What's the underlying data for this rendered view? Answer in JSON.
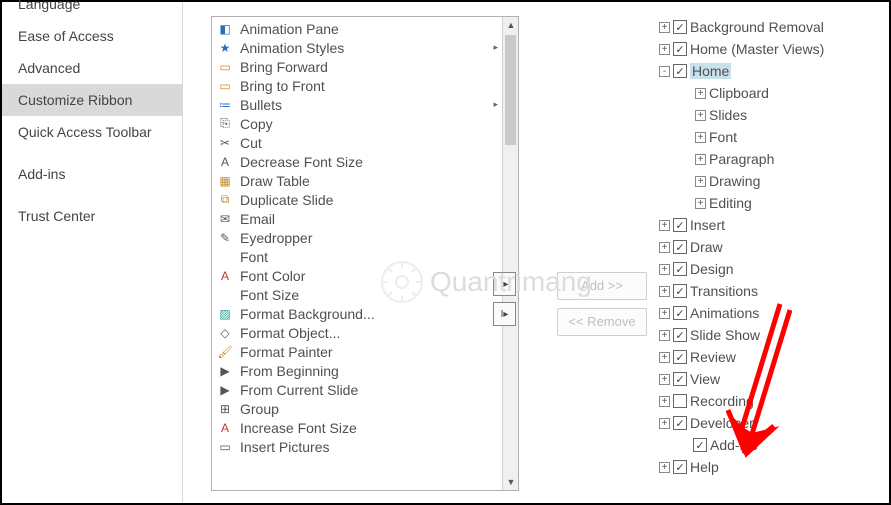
{
  "nav": {
    "items": [
      {
        "label": "Language",
        "selected": false
      },
      {
        "label": "Ease of Access",
        "selected": false
      },
      {
        "label": "Advanced",
        "selected": false
      },
      {
        "label": "Customize Ribbon",
        "selected": true
      },
      {
        "label": "Quick Access Toolbar",
        "selected": false
      },
      {
        "label": "Add-ins",
        "selected": false
      },
      {
        "label": "Trust Center",
        "selected": false
      }
    ]
  },
  "commands": [
    {
      "icon": "pane-icon",
      "glyph": "◧",
      "color": "#2a6fbf",
      "label": "Animation Pane"
    },
    {
      "icon": "star-icon",
      "glyph": "★",
      "color": "#2a6fbf",
      "label": "Animation Styles",
      "submenu": true
    },
    {
      "icon": "bring-forward-icon",
      "glyph": "▭",
      "color": "#d48b2a",
      "label": "Bring Forward"
    },
    {
      "icon": "bring-to-front-icon",
      "glyph": "▭",
      "color": "#d48b2a",
      "label": "Bring to Front"
    },
    {
      "icon": "bullets-icon",
      "glyph": "≔",
      "color": "#2a6fbf",
      "label": "Bullets",
      "submenu": true
    },
    {
      "icon": "copy-icon",
      "glyph": "⎘",
      "color": "#555",
      "label": "Copy"
    },
    {
      "icon": "cut-icon",
      "glyph": "✂",
      "color": "#555",
      "label": "Cut"
    },
    {
      "icon": "decrease-font-icon",
      "glyph": "A",
      "color": "#555",
      "label": "Decrease Font Size"
    },
    {
      "icon": "draw-table-icon",
      "glyph": "▦",
      "color": "#c58a2a",
      "label": "Draw Table"
    },
    {
      "icon": "duplicate-slide-icon",
      "glyph": "⧉",
      "color": "#c58a2a",
      "label": "Duplicate Slide"
    },
    {
      "icon": "email-icon",
      "glyph": "✉",
      "color": "#555",
      "label": "Email"
    },
    {
      "icon": "eyedropper-icon",
      "glyph": "✎",
      "color": "#555",
      "label": "Eyedropper"
    },
    {
      "icon": "font-icon",
      "glyph": " ",
      "color": "#555",
      "label": "Font"
    },
    {
      "icon": "font-color-icon",
      "glyph": "A",
      "color": "#c0392b",
      "label": "Font Color"
    },
    {
      "icon": "font-size-icon",
      "glyph": " ",
      "color": "#555",
      "label": "Font Size"
    },
    {
      "icon": "format-background-icon",
      "glyph": "▨",
      "color": "#2a9d8f",
      "label": "Format Background..."
    },
    {
      "icon": "format-object-icon",
      "glyph": "◇",
      "color": "#555",
      "label": "Format Object..."
    },
    {
      "icon": "format-painter-icon",
      "glyph": "🖌",
      "color": "#c58a2a",
      "label": "Format Painter"
    },
    {
      "icon": "from-beginning-icon",
      "glyph": "▶",
      "color": "#555",
      "label": "From Beginning"
    },
    {
      "icon": "from-current-slide-icon",
      "glyph": "▶",
      "color": "#555",
      "label": "From Current Slide"
    },
    {
      "icon": "group-icon",
      "glyph": "⊞",
      "color": "#555",
      "label": "Group"
    },
    {
      "icon": "increase-font-icon",
      "glyph": "A",
      "color": "#c0392b",
      "label": "Increase Font Size"
    },
    {
      "icon": "insert-pictures-icon",
      "glyph": "▭",
      "color": "#555",
      "label": "Insert Pictures"
    }
  ],
  "buttons": {
    "add": "Add >>",
    "remove": "<< Remove"
  },
  "tree": [
    {
      "depth": 0,
      "expander": "+",
      "checked": true,
      "label": "Background Removal"
    },
    {
      "depth": 0,
      "expander": "+",
      "checked": true,
      "label": "Home (Master Views)"
    },
    {
      "depth": 0,
      "expander": "-",
      "checked": true,
      "label": "Home",
      "selected": true
    },
    {
      "depth": 2,
      "expander": "+",
      "checked": null,
      "label": "Clipboard"
    },
    {
      "depth": 2,
      "expander": "+",
      "checked": null,
      "label": "Slides"
    },
    {
      "depth": 2,
      "expander": "+",
      "checked": null,
      "label": "Font"
    },
    {
      "depth": 2,
      "expander": "+",
      "checked": null,
      "label": "Paragraph"
    },
    {
      "depth": 2,
      "expander": "+",
      "checked": null,
      "label": "Drawing"
    },
    {
      "depth": 2,
      "expander": "+",
      "checked": null,
      "label": "Editing"
    },
    {
      "depth": 0,
      "expander": "+",
      "checked": true,
      "label": "Insert"
    },
    {
      "depth": 0,
      "expander": "+",
      "checked": true,
      "label": "Draw"
    },
    {
      "depth": 0,
      "expander": "+",
      "checked": true,
      "label": "Design"
    },
    {
      "depth": 0,
      "expander": "+",
      "checked": true,
      "label": "Transitions"
    },
    {
      "depth": 0,
      "expander": "+",
      "checked": true,
      "label": "Animations"
    },
    {
      "depth": 0,
      "expander": "+",
      "checked": true,
      "label": "Slide Show"
    },
    {
      "depth": 0,
      "expander": "+",
      "checked": true,
      "label": "Review"
    },
    {
      "depth": 0,
      "expander": "+",
      "checked": true,
      "label": "View"
    },
    {
      "depth": 0,
      "expander": "+",
      "checked": false,
      "label": "Recording"
    },
    {
      "depth": 0,
      "expander": "+",
      "checked": true,
      "label": "Developer"
    },
    {
      "depth": 1,
      "expander": "",
      "checked": true,
      "label": "Add-ins"
    },
    {
      "depth": 0,
      "expander": "+",
      "checked": true,
      "label": "Help"
    }
  ],
  "watermark": "Quantrimang"
}
